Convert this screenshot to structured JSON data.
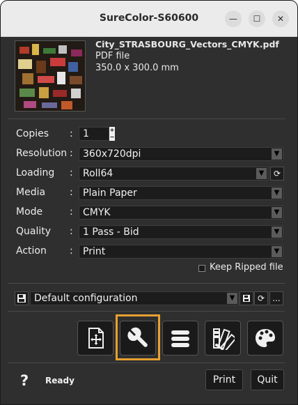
{
  "window": {
    "title": "SureColor-S60600",
    "minimize_glyph": "—",
    "maximize_glyph": "☐",
    "close_glyph": "✕"
  },
  "file": {
    "name": "City_STRASBOURG_Vectors_CMYK.pdf",
    "type": "PDF file",
    "size": "350.0 x 300.0 mm"
  },
  "settings": {
    "separator": ":",
    "copies_label": "Copies",
    "copies_value": "1",
    "resolution_label": "Resolution",
    "resolution_value": "360x720dpi",
    "loading_label": "Loading",
    "loading_value": "Roll64",
    "media_label": "Media",
    "media_value": "Plain Paper",
    "mode_label": "Mode",
    "mode_value": "CMYK",
    "quality_label": "Quality",
    "quality_value": "1 Pass - Bid",
    "action_label": "Action",
    "action_value": "Print",
    "keep_ripped_label": "Keep Ripped file",
    "keep_ripped_checked": false
  },
  "configuration": {
    "value": "Default configuration",
    "more_label": "..."
  },
  "toolbar": {
    "items": [
      "layout-icon",
      "wrench-icon",
      "list-icon",
      "swatches-icon",
      "palette-icon"
    ],
    "selected": "wrench-icon",
    "highlight_color": "#e8a030"
  },
  "footer": {
    "help_label": "?",
    "status": "Ready",
    "print_label": "Print",
    "quit_label": "Quit"
  },
  "colors": {
    "background": "#2f2f2f",
    "field": "#1c1c1c",
    "text": "#ececec"
  }
}
